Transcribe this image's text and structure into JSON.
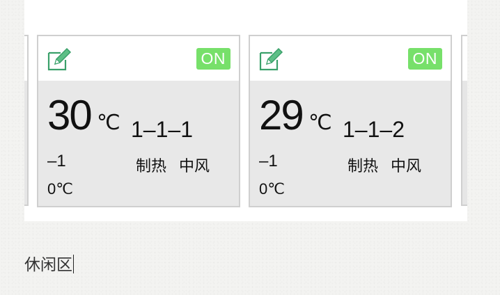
{
  "cards": [
    {
      "status": "ON",
      "temperature": "30",
      "unit": "℃",
      "room_id": "1–1–1",
      "sub_value": "–1",
      "mode": "制热",
      "fan_speed": "中风",
      "set_temp": "0℃"
    },
    {
      "status": "ON",
      "temperature": "29",
      "unit": "℃",
      "room_id": "1–1–2",
      "sub_value": "–1",
      "mode": "制热",
      "fan_speed": "中风",
      "set_temp": "0℃"
    }
  ],
  "zone_label": "休闲区",
  "colors": {
    "on_badge": "#77e06a",
    "card_body": "#e8e8e8",
    "icon": "#3aa06a"
  },
  "icons": {
    "edit": "edit-icon"
  }
}
